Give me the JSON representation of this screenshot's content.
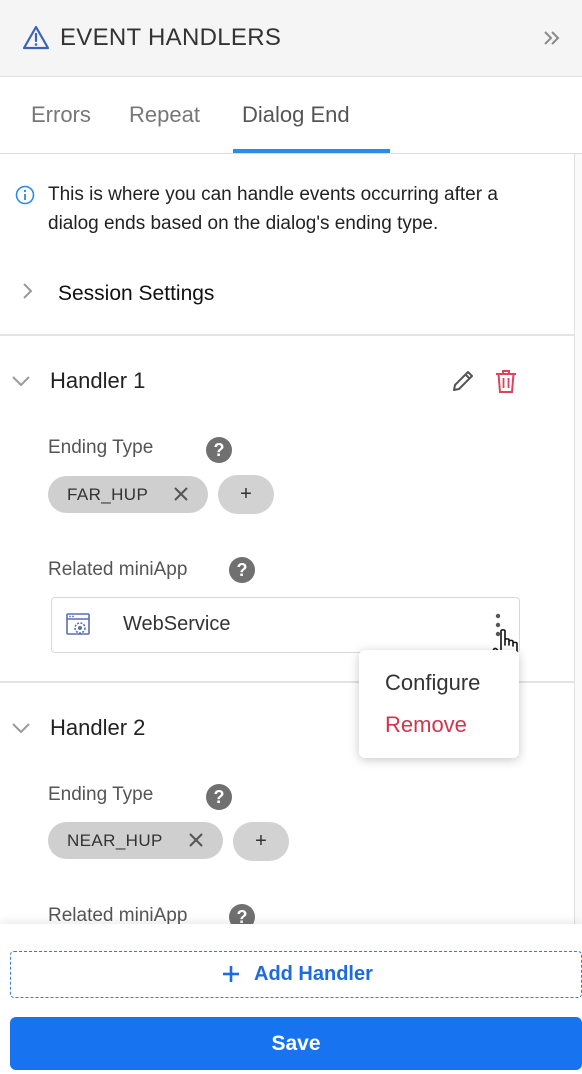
{
  "header": {
    "title": "EVENT HANDLERS",
    "icon": "warning-triangle-icon",
    "collapse_icon": "double-chevron-right-icon"
  },
  "tabs": [
    {
      "label": "Errors",
      "active": false
    },
    {
      "label": "Repeat",
      "active": false
    },
    {
      "label": "Dialog End",
      "active": true
    }
  ],
  "info": {
    "icon": "info-icon",
    "text": "This is where you can handle events occurring after a dialog ends based on the dialog's ending type."
  },
  "session_settings": {
    "label": "Session Settings",
    "expanded": false
  },
  "handlers": [
    {
      "title": "Handler 1",
      "ending_type_label": "Ending Type",
      "ending_types": [
        "FAR_HUP"
      ],
      "add_label": "+",
      "related_label": "Related miniApp",
      "miniapp": {
        "name": "WebService",
        "icon": "webservice-icon"
      }
    },
    {
      "title": "Handler 2",
      "ending_type_label": "Ending Type",
      "ending_types": [
        "NEAR_HUP"
      ],
      "add_label": "+",
      "related_label": "Related miniApp"
    }
  ],
  "context_menu": {
    "items": [
      "Configure",
      "Remove"
    ]
  },
  "footer": {
    "add_handler_label": "Add Handler",
    "save_label": "Save"
  },
  "colors": {
    "accent": "#1773f0",
    "tab_underline": "#2d8ae8",
    "danger": "#d0344d",
    "chip_bg": "#cfcfcf"
  }
}
